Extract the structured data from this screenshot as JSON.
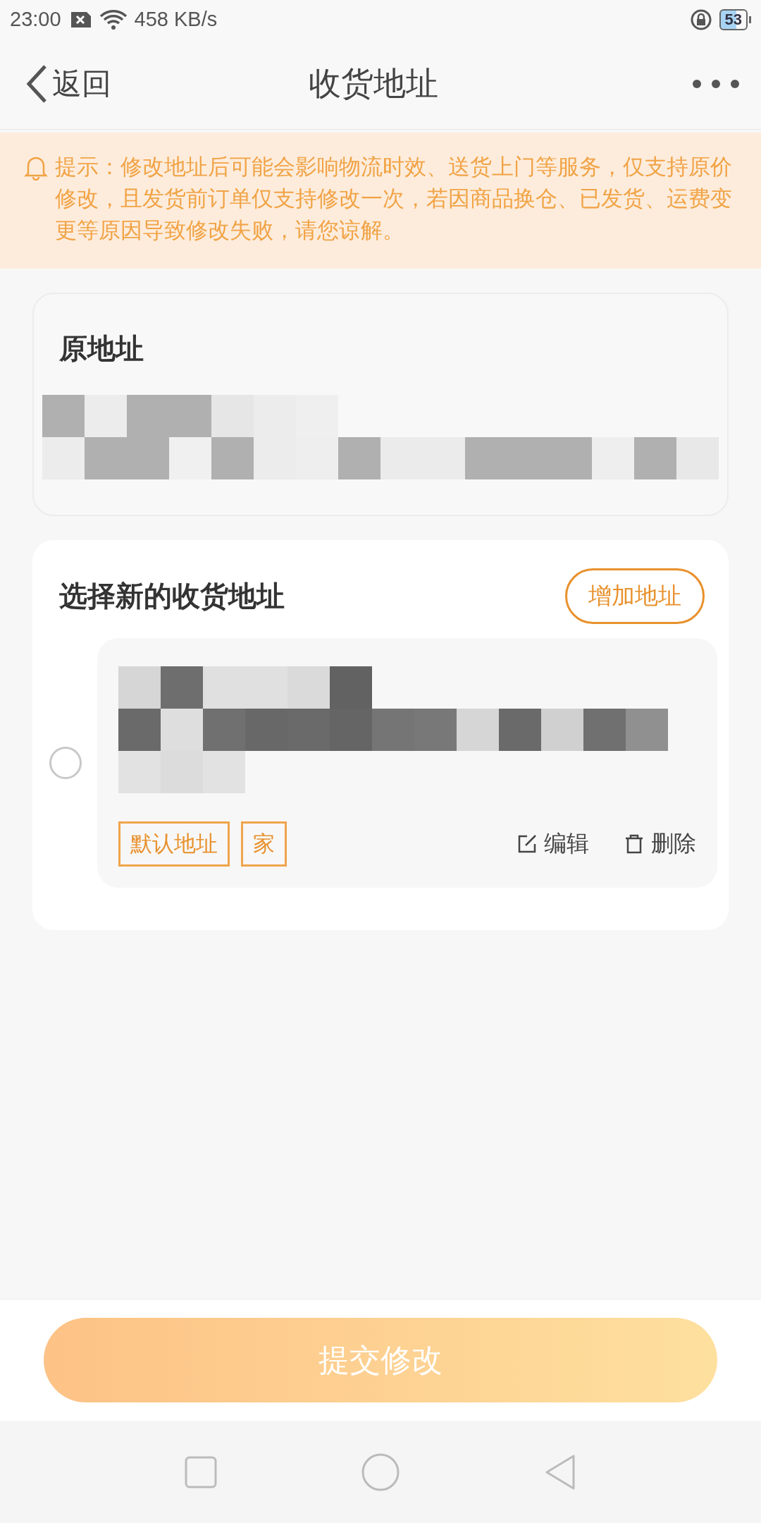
{
  "status_bar": {
    "time": "23:00",
    "network_speed": "458 KB/s",
    "battery": "53"
  },
  "header": {
    "back_label": "返回",
    "title": "收货地址"
  },
  "notice": {
    "text": "提示：修改地址后可能会影响物流时效、送货上门等服务，仅支持原价修改，且发货前订单仅支持修改一次，若因商品换仓、已发货、运费变更等原因导致修改失败，请您谅解。"
  },
  "original_address": {
    "title": "原地址"
  },
  "new_address": {
    "title": "选择新的收货地址",
    "add_button": "增加地址",
    "addresses": [
      {
        "selected": false,
        "tags": [
          "默认地址",
          "家"
        ],
        "edit_label": "编辑",
        "delete_label": "删除"
      }
    ]
  },
  "submit_button": {
    "label": "提交修改",
    "disabled": true
  }
}
